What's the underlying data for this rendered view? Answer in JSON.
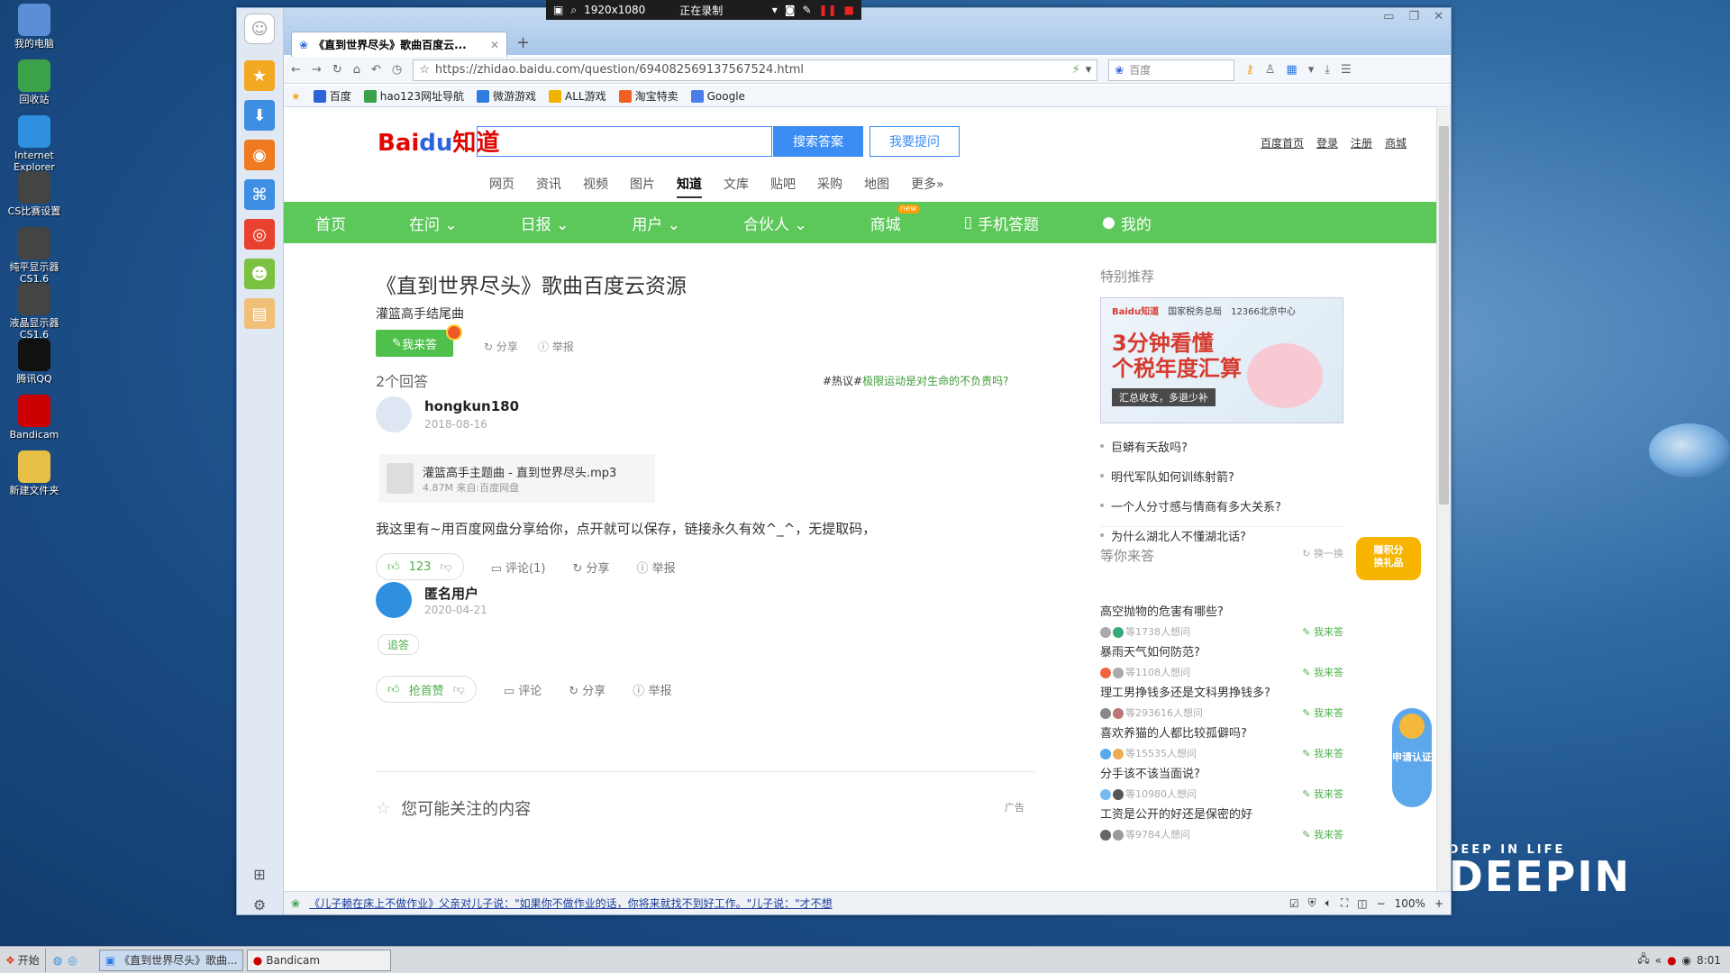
{
  "desktop": {
    "icons": [
      {
        "label": "我的电脑",
        "icon": "computer-icon",
        "color": "#5a8fd8"
      },
      {
        "label": "回收站",
        "icon": "recycle-bin-icon",
        "color": "#3ca24a"
      },
      {
        "label": "Internet Explorer",
        "icon": "ie-icon",
        "color": "#2f8fe0"
      },
      {
        "label": "CS比赛设置",
        "icon": "cs-icon",
        "color": "#444"
      },
      {
        "label": "纯平显示器 CS1.6",
        "icon": "cs-icon",
        "color": "#444"
      },
      {
        "label": "液晶显示器 CS1.6",
        "icon": "cs-icon",
        "color": "#444"
      },
      {
        "label": "腾讯QQ",
        "icon": "qq-icon",
        "color": "#111"
      },
      {
        "label": "Bandicam",
        "icon": "bandicam-icon",
        "color": "#c00"
      },
      {
        "label": "新建文件夹",
        "icon": "folder-icon",
        "color": "#e9c046"
      }
    ],
    "brand_small": "DEEP IN LIFE",
    "brand_big": "DEEPIN"
  },
  "recorder": {
    "resolution": "1920x1080",
    "status": "正在录制"
  },
  "taskbar": {
    "start": "开始",
    "tasks": [
      "《直到世界尽头》歌曲...",
      "Bandicam"
    ],
    "time": "8:01"
  },
  "browser": {
    "tab_title": "《直到世界尽头》歌曲百度云...",
    "url": "https://zhidao.baidu.com/question/694082569137567524.html",
    "search_placeholder": "百度",
    "bookmarks": [
      {
        "label": "百度",
        "color": "#2d63d8"
      },
      {
        "label": "hao123网址导航",
        "color": "#3ca24a"
      },
      {
        "label": "微游游戏",
        "color": "#2f7de0"
      },
      {
        "label": "ALL游戏",
        "color": "#f0b400"
      },
      {
        "label": "淘宝特卖",
        "color": "#f06020"
      },
      {
        "label": "Google",
        "color": "#4a7de8"
      }
    ],
    "status_news": "《儿子赖在床上不做作业》父亲对儿子说：\"如果你不做作业的话，你将来就找不到好工作。\"儿子说：\"才不想",
    "zoom": "100%"
  },
  "zhidao": {
    "logo_a": "Bai",
    "logo_b": "du",
    "logo_c": "知道",
    "search_button": "搜索答案",
    "ask_button": "我要提问",
    "top_links": [
      "百度首页",
      "登录",
      "注册",
      "商城"
    ],
    "categories": [
      "网页",
      "资讯",
      "视频",
      "图片",
      "知道",
      "文库",
      "贴吧",
      "采购",
      "地图",
      "更多»"
    ],
    "active_category": "知道",
    "green_nav": [
      "首页",
      "在问 ⌄",
      "日报 ⌄",
      "用户 ⌄",
      "合伙人 ⌄",
      "商城",
      "手机答题",
      "我的"
    ],
    "new_badge": "new",
    "question_title": "《直到世界尽头》歌曲百度云资源",
    "question_sub": "灌篮高手结尾曲",
    "answer_button": "我来答",
    "share": "分享",
    "report": "举报",
    "answer_count": "2个回答",
    "hot_prefix": "#热议#",
    "hot_text": "极限运动是对生命的不负责吗?",
    "answers": [
      {
        "user": "hongkun180",
        "date": "2018-08-16",
        "file_name": "灌篮高手主题曲 - 直到世界尽头.mp3",
        "file_meta": "4.87M   来自:百度网盘",
        "text": "我这里有~用百度网盘分享给你，点开就可以保存，链接永久有效^_^，无提取码，",
        "likes": "123",
        "comment": "评论(1)",
        "share": "分享",
        "report": "举报"
      },
      {
        "user": "匿名用户",
        "date": "2020-04-21",
        "followup": "追答",
        "likes": "抢首赞",
        "comment": "评论",
        "share": "分享",
        "report": "举报"
      }
    ],
    "may_like": "您可能关注的内容",
    "ad": "广告",
    "special_title": "特别推荐",
    "banner": {
      "logos": [
        "Baidu知道",
        "国家税务总局",
        "12366北京中心"
      ],
      "line1": "3分钟看懂",
      "line2": "个税年度汇算",
      "slogan": "汇总收支，多退少补"
    },
    "recommend": [
      "巨蟒有天敌吗?",
      "明代军队如何训练射箭?",
      "一个人分寸感与情商有多大关系?",
      "为什么湖北人不懂湖北话?"
    ],
    "waiting_title": "等你来答",
    "refresh": "换一换",
    "waiting": [
      {
        "q": "高空抛物的危害有哪些?",
        "n": "等1738人想问",
        "go": "我来答"
      },
      {
        "q": "暴雨天气如何防范?",
        "n": "等1108人想问",
        "go": "我来答"
      },
      {
        "q": "理工男挣钱多还是文科男挣钱多?",
        "n": "等293616人想问",
        "go": "我来答"
      },
      {
        "q": "喜欢养猫的人都比较孤僻吗?",
        "n": "等15535人想问",
        "go": "我来答"
      },
      {
        "q": "分手该不该当面说?",
        "n": "等10980人想问",
        "go": "我来答"
      },
      {
        "q": "工资是公开的好还是保密的好",
        "n": "等9784人想问",
        "go": "我来答"
      }
    ],
    "float_points": "赚积分\n换礼品",
    "float_verify": "申请认证"
  },
  "colors": {
    "green": "#5cc85a",
    "blue": "#3b8cf3",
    "red": "#e10601"
  }
}
